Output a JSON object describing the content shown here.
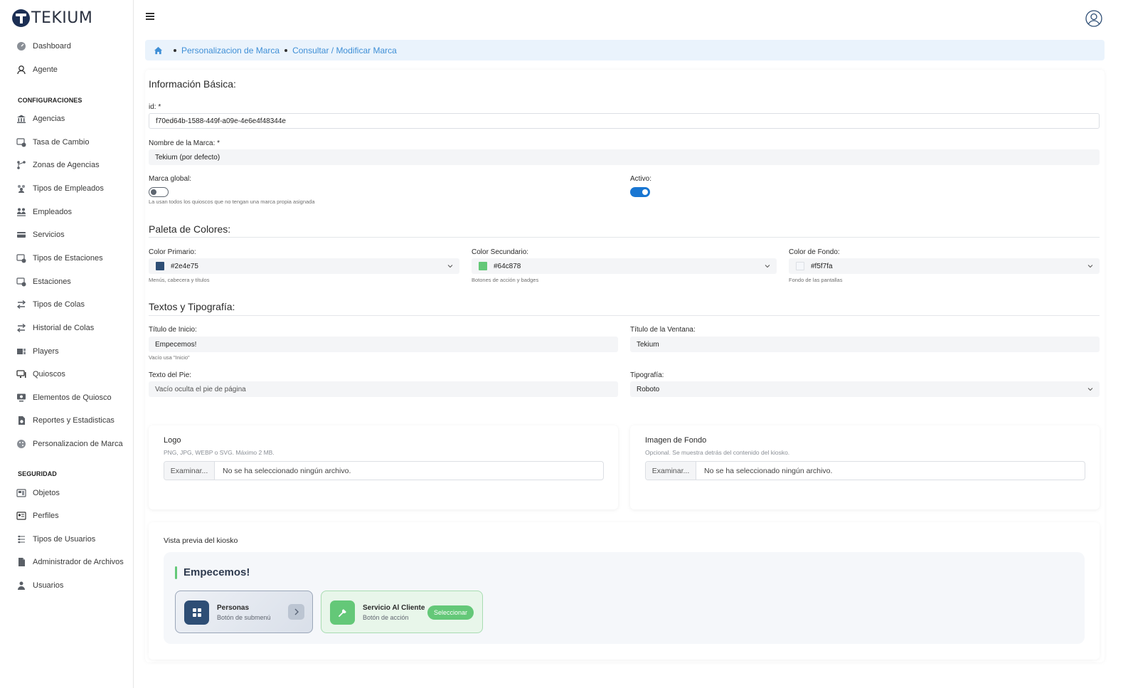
{
  "brand": {
    "logo_text": "TEKIUM"
  },
  "sidebar": {
    "top_items": [
      {
        "label": "Dashboard",
        "icon": "gauge-icon"
      },
      {
        "label": "Agente",
        "icon": "user-agent-icon"
      }
    ],
    "section_config": "CONFIGURACIONES",
    "config_items": [
      {
        "label": "Agencias",
        "icon": "bank-icon"
      },
      {
        "label": "Tasa de Cambio",
        "icon": "exchange-icon"
      },
      {
        "label": "Zonas de Agencias",
        "icon": "zones-icon"
      },
      {
        "label": "Tipos de Empleados",
        "icon": "group-icon"
      },
      {
        "label": "Empleados",
        "icon": "employees-icon"
      },
      {
        "label": "Servicios",
        "icon": "card-icon"
      },
      {
        "label": "Tipos de Estaciones",
        "icon": "station-type-icon"
      },
      {
        "label": "Estaciones",
        "icon": "station-icon"
      },
      {
        "label": "Tipos de Colas",
        "icon": "queue-type-icon"
      },
      {
        "label": "Historial de Colas",
        "icon": "queue-history-icon"
      },
      {
        "label": "Players",
        "icon": "player-icon"
      },
      {
        "label": "Quioscos",
        "icon": "kiosk-icon"
      },
      {
        "label": "Elementos de Quiosco",
        "icon": "kiosk-elements-icon"
      },
      {
        "label": "Reportes y Estadisticas",
        "icon": "report-icon"
      },
      {
        "label": "Personalizacion de Marca",
        "icon": "palette-icon"
      }
    ],
    "section_security": "SEGURIDAD",
    "security_items": [
      {
        "label": "Objetos",
        "icon": "objects-icon"
      },
      {
        "label": "Perfiles",
        "icon": "profile-card-icon"
      },
      {
        "label": "Tipos de Usuarios",
        "icon": "user-types-icon"
      },
      {
        "label": "Administrador de Archivos",
        "icon": "file-icon"
      },
      {
        "label": "Usuarios",
        "icon": "users-icon"
      }
    ]
  },
  "breadcrumb": {
    "items": [
      "Personalizacion de Marca",
      "Consultar / Modificar Marca"
    ]
  },
  "basic": {
    "title": "Información Básica:",
    "id_label": "id: *",
    "id_value": "f70ed64b-1588-449f-a09e-4e6e4f48344e",
    "name_label": "Nombre de la Marca: *",
    "name_value": "Tekium (por defecto)",
    "global_label": "Marca global:",
    "global_hint": "La usan todos los quioscos que no tengan una marca propia asignada",
    "global_on": false,
    "active_label": "Activo:",
    "active_on": true
  },
  "palette": {
    "title": "Paleta de Colores:",
    "primary": {
      "label": "Color Primario:",
      "value": "#2e4e75",
      "hint": "Menús, cabecera y títulos"
    },
    "secondary": {
      "label": "Color Secundario:",
      "value": "#64c878",
      "hint": "Botones de acción y badges"
    },
    "background": {
      "label": "Color de Fondo:",
      "value": "#f5f7fa",
      "hint": "Fondo de las pantallas"
    }
  },
  "texts": {
    "title": "Textos y Tipografía:",
    "home_title_label": "Título de Inicio:",
    "home_title_value": "Empecemos!",
    "home_title_hint": "Vacío usa \"Inicio\"",
    "window_title_label": "Título de la Ventana:",
    "window_title_value": "Tekium",
    "footer_label": "Texto del Pie:",
    "footer_placeholder": "Vacío oculta el pie de página",
    "font_label": "Tipografía:",
    "font_value": "Roboto"
  },
  "uploads": {
    "logo": {
      "title": "Logo",
      "hint": "PNG, JPG, WEBP o SVG. Máximo 2 MB.",
      "button": "Examinar...",
      "status": "No se ha seleccionado ningún archivo."
    },
    "background": {
      "title": "Imagen de Fondo",
      "hint": "Opcional. Se muestra detrás del contenido del kiosko.",
      "button": "Examinar...",
      "status": "No se ha seleccionado ningún archivo."
    }
  },
  "preview": {
    "label": "Vista previa del kiosko",
    "title": "Empecemos!",
    "submenu": {
      "title": "Personas",
      "subtitle": "Botón de submenú"
    },
    "action": {
      "title": "Servicio Al Cliente",
      "subtitle": "Botón de acción",
      "button": "Seleccionar"
    }
  }
}
